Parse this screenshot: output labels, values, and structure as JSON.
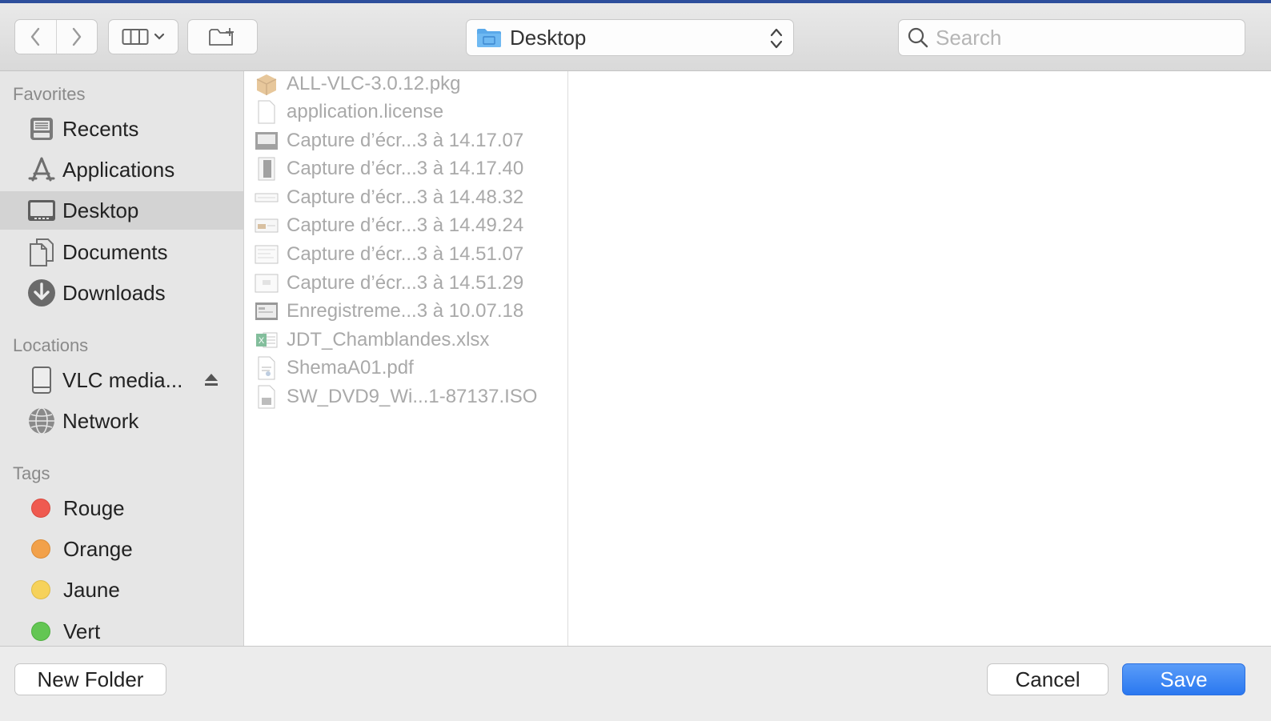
{
  "toolbar": {
    "location": "Desktop",
    "search_placeholder": "Search"
  },
  "sidebar": {
    "favorites_header": "Favorites",
    "favorites": [
      {
        "label": "Recents",
        "icon": "recents-icon"
      },
      {
        "label": "Applications",
        "icon": "applications-icon"
      },
      {
        "label": "Desktop",
        "icon": "desktop-icon",
        "selected": true
      },
      {
        "label": "Documents",
        "icon": "documents-icon"
      },
      {
        "label": "Downloads",
        "icon": "downloads-icon"
      }
    ],
    "locations_header": "Locations",
    "locations": [
      {
        "label": "VLC media...",
        "icon": "disk-icon",
        "eject": true
      },
      {
        "label": "Network",
        "icon": "network-icon"
      }
    ],
    "tags_header": "Tags",
    "tags": [
      {
        "label": "Rouge",
        "color": "#ef5a50"
      },
      {
        "label": "Orange",
        "color": "#f2a14a"
      },
      {
        "label": "Jaune",
        "color": "#f6d25b"
      },
      {
        "label": "Vert",
        "color": "#63c653"
      }
    ]
  },
  "files": [
    {
      "name": "ALL-VLC-3.0.12.pkg",
      "icon": "package-icon"
    },
    {
      "name": "application.license",
      "icon": "document-icon"
    },
    {
      "name": "Capture d’écr...3 à 14.17.07",
      "icon": "image-thumbnail-icon"
    },
    {
      "name": "Capture d’écr...3 à 14.17.40",
      "icon": "image-thumbnail-icon"
    },
    {
      "name": "Capture d’écr...3 à 14.48.32",
      "icon": "image-thumbnail-icon"
    },
    {
      "name": "Capture d’écr...3 à 14.49.24",
      "icon": "image-thumbnail-icon"
    },
    {
      "name": "Capture d’écr...3 à 14.51.07",
      "icon": "image-thumbnail-icon"
    },
    {
      "name": "Capture d’écr...3 à 14.51.29",
      "icon": "image-thumbnail-icon"
    },
    {
      "name": "Enregistreme...3 à 10.07.18",
      "icon": "video-thumbnail-icon"
    },
    {
      "name": "JDT_Chamblandes.xlsx",
      "icon": "excel-icon"
    },
    {
      "name": "ShemaA01.pdf",
      "icon": "pdf-icon"
    },
    {
      "name": "SW_DVD9_Wi...1-87137.ISO",
      "icon": "disk-image-icon"
    }
  ],
  "buttons": {
    "new_folder": "New Folder",
    "cancel": "Cancel",
    "save": "Save"
  },
  "colors": {
    "accent": "#2a78f0",
    "selected_sidebar": "#d3d3d3",
    "folder_blue": "#5aa9ea"
  }
}
